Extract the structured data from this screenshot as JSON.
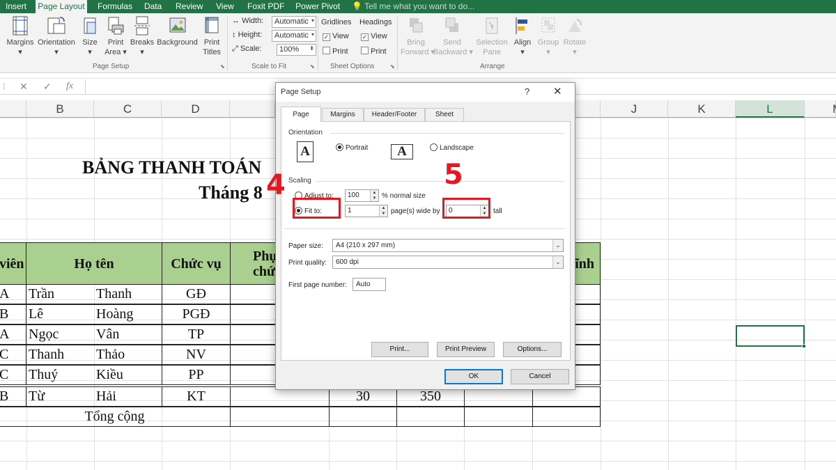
{
  "ribbon_tabs": [
    "Insert",
    "Page Layout",
    "Formulas",
    "Data",
    "Review",
    "View",
    "Foxit PDF",
    "Power Pivot"
  ],
  "tell_me": "Tell me what you want to do...",
  "ribbon": {
    "margins": "Margins",
    "orientation": "Orientation",
    "size": "Size",
    "print_area_1": "Print",
    "print_area_2": "Area",
    "breaks": "Breaks",
    "background": "Background",
    "print_titles_1": "Print",
    "print_titles_2": "Titles",
    "page_setup_group": "Page Setup",
    "width_label": "Width:",
    "width_value": "Automatic",
    "height_label": "Height:",
    "height_value": "Automatic",
    "scale_label": "Scale:",
    "scale_value": "100%",
    "scale_group": "Scale to Fit",
    "gridlines": "Gridlines",
    "headings": "Headings",
    "view": "View",
    "print": "Print",
    "sheet_options_group": "Sheet Options",
    "bring_forward_1": "Bring",
    "bring_forward_2": "Forward",
    "send_backward_1": "Send",
    "send_backward_2": "Backward",
    "selection_pane_1": "Selection",
    "selection_pane_2": "Pane",
    "align": "Align",
    "group": "Group",
    "rotate": "Rotate",
    "arrange_group": "Arrange"
  },
  "formula_bar": {
    "cancel": "✕",
    "enter": "✓",
    "fx": "fx"
  },
  "columns": [
    "B",
    "C",
    "D",
    "J",
    "K",
    "L",
    "M"
  ],
  "sheet": {
    "title": "BẢNG THANH TOÁN",
    "subtitle": "Tháng 8",
    "headers": [
      "viên",
      "Họ tên",
      "Chức vụ",
      "Phụ",
      "chứ",
      "ĩnh"
    ],
    "rows": [
      [
        "A",
        "Trần",
        "Thanh",
        "GĐ"
      ],
      [
        "B",
        "Lê",
        "Hoàng",
        "PGĐ"
      ],
      [
        "A",
        "Ngọc",
        "Vân",
        "TP"
      ],
      [
        "C",
        "Thanh",
        "Thảo",
        "NV"
      ],
      [
        "C",
        "Thuý",
        "Kiều",
        "PP"
      ],
      [
        "B",
        "Từ",
        "Hải",
        "KT"
      ]
    ],
    "last_row_values": [
      "30",
      "350"
    ],
    "total_label": "Tổng cộng"
  },
  "dialog": {
    "title": "Page Setup",
    "help": "?",
    "close": "✕",
    "tabs": [
      "Page",
      "Margins",
      "Header/Footer",
      "Sheet"
    ],
    "orientation_label": "Orientation",
    "portrait": "Portrait",
    "landscape": "Landscape",
    "orient_icon": "A",
    "scaling_label": "Scaling",
    "adjust_to": "Adjust to:",
    "adjust_value": "100",
    "normal_size": "% normal size",
    "fit_to": "Fit to:",
    "fit_wide_value": "1",
    "pages_wide_by": "page(s) wide by",
    "fit_tall_value": "0",
    "tall": "tall",
    "paper_size_label": "Paper size:",
    "paper_size_value": "A4 (210 x 297 mm)",
    "print_quality_label": "Print quality:",
    "print_quality_value": "600 dpi",
    "first_page_label": "First page number:",
    "first_page_value": "Auto",
    "print_btn": "Print...",
    "preview_btn": "Print Preview",
    "options_btn": "Options...",
    "ok_btn": "OK",
    "cancel_btn": "Cancel"
  },
  "annotations": [
    "4",
    "5"
  ]
}
